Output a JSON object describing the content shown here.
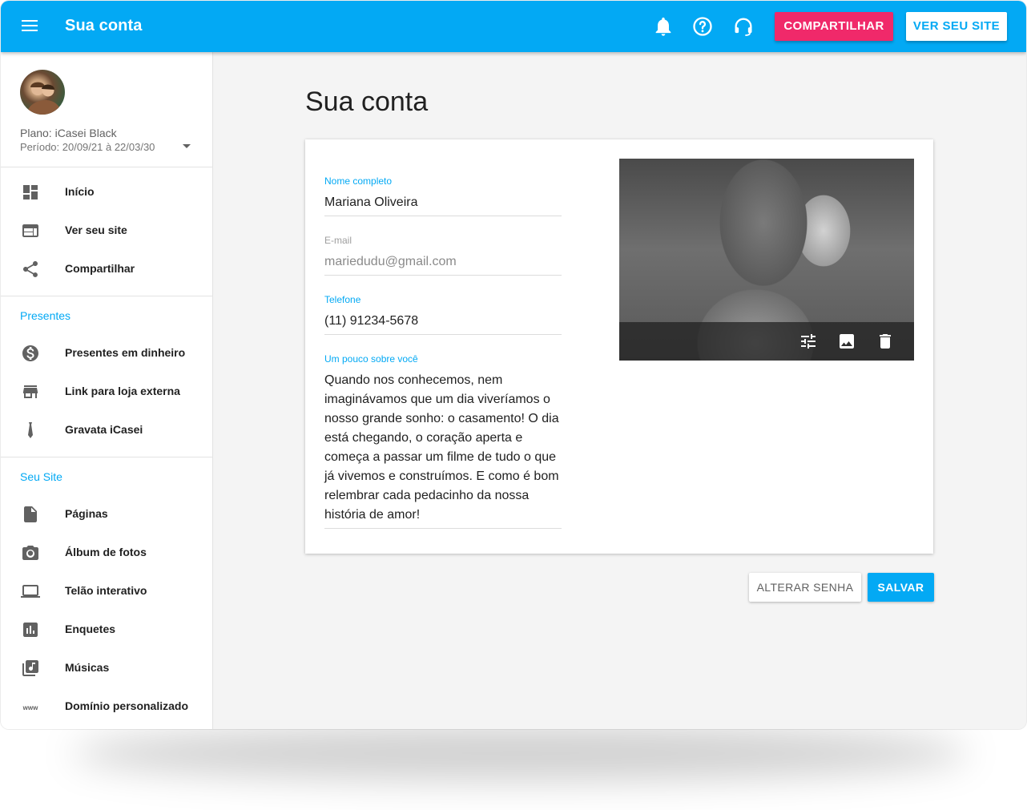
{
  "header": {
    "title": "Sua conta",
    "share_label": "COMPARTILHAR",
    "view_site_label": "VER SEU SITE",
    "icons": [
      "menu-icon",
      "bell-icon",
      "help-icon",
      "support-headset-icon"
    ]
  },
  "sidebar": {
    "plan": "Plano: iCasei Black",
    "period": "Período: 20/09/21 à 22/03/30",
    "main_items": [
      {
        "label": "Início",
        "icon": "dashboard-icon"
      },
      {
        "label": "Ver seu site",
        "icon": "web-icon"
      },
      {
        "label": "Compartilhar",
        "icon": "share-icon"
      }
    ],
    "sections": [
      {
        "title": "Presentes",
        "items": [
          {
            "label": "Presentes em dinheiro",
            "icon": "money-icon"
          },
          {
            "label": "Link para loja externa",
            "icon": "store-icon"
          },
          {
            "label": "Gravata iCasei",
            "icon": "tie-icon"
          }
        ]
      },
      {
        "title": "Seu Site",
        "items": [
          {
            "label": "Páginas",
            "icon": "page-icon"
          },
          {
            "label": "Álbum de fotos",
            "icon": "camera-icon"
          },
          {
            "label": "Telão interativo",
            "icon": "screen-icon"
          },
          {
            "label": "Enquetes",
            "icon": "poll-icon"
          },
          {
            "label": "Músicas",
            "icon": "music-icon"
          },
          {
            "label": "Domínio personalizado",
            "icon": "www-icon"
          }
        ]
      }
    ]
  },
  "main": {
    "title": "Sua conta",
    "fields": {
      "name": {
        "label": "Nome completo",
        "value": "Mariana Oliveira"
      },
      "email": {
        "label": "E-mail",
        "value": "mariedudu@gmail.com"
      },
      "phone": {
        "label": "Telefone",
        "value": "(11) 91234-5678"
      },
      "about": {
        "label": "Um pouco sobre você",
        "value": "Quando nos conhecemos, nem imaginávamos que um dia viveríamos o nosso grande sonho: o casamento! O dia está chegando, o coração aperta e começa a passar um filme de tudo o que já vivemos e construímos. E como é bom relembrar cada pedacinho da nossa história de amor!"
      }
    },
    "photo_actions": [
      "adjust-icon",
      "image-icon",
      "delete-icon"
    ],
    "change_password_label": "ALTERAR SENHA",
    "save_label": "SALVAR"
  },
  "colors": {
    "primary": "#03a9f4",
    "accent": "#f0296a"
  }
}
